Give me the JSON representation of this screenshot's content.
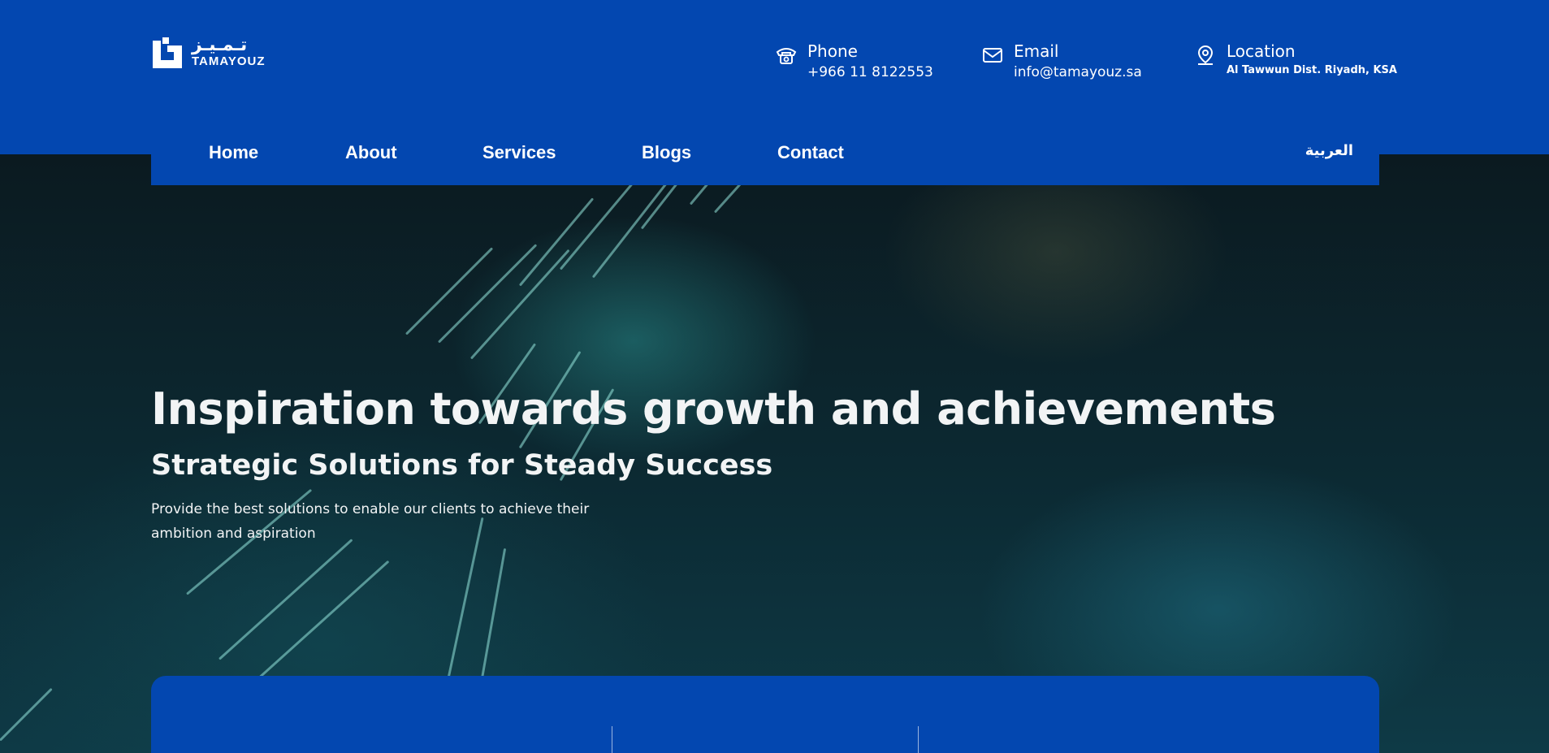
{
  "brand": {
    "name_ar": "تـمـيـز",
    "name_en": "TAMAYOUZ"
  },
  "contact": {
    "phone": {
      "label": "Phone",
      "value": "+966 11 8122553",
      "icon": "phone-icon"
    },
    "email": {
      "label": "Email",
      "value": "info@tamayouz.sa",
      "icon": "mail-icon"
    },
    "location": {
      "label": "Location",
      "value": "Al Tawwun Dist. Riyadh, KSA",
      "icon": "location-pin-icon"
    }
  },
  "nav": {
    "items": [
      "Home",
      "About",
      "Services",
      "Blogs",
      "Contact"
    ],
    "language": "العربية"
  },
  "hero": {
    "title": "Inspiration towards growth and achievements",
    "subtitle": "Strategic Solutions for Steady Success",
    "description": "Provide the best solutions to enable our clients to achieve their ambition and aspiration"
  },
  "colors": {
    "brand_blue": "#0347b0",
    "text": "#f2f4f5"
  }
}
